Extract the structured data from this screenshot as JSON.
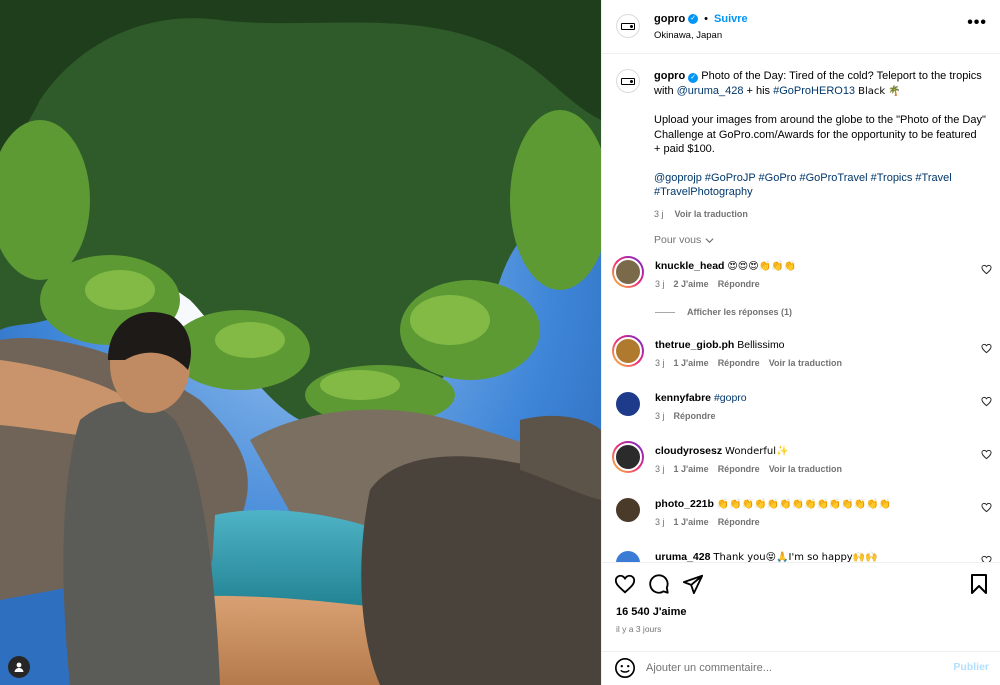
{
  "post": {
    "account": "gopro",
    "follow_label": "Suivre",
    "dot": "•",
    "location": "Okinawa, Japan",
    "more_label": "•••"
  },
  "caption": {
    "user": "gopro",
    "line1_text": "Photo of the Day: Tired of the cold? Teleport to the tropics with",
    "mention": "@uruma_428",
    "mid_text": "+ his",
    "hashtag_camera": "#GoProHERO13",
    "end_text": "Black 🌴",
    "paragraph2": "Upload your images from around the globe to the \"Photo of the Day\" Challenge at GoPro.com/Awards for the opportunity to be featured + paid $100.",
    "hashtags": "@goprojp #GoProJP #GoPro #GoProTravel #Tropics #Travel #TravelPhotography",
    "time": "3 j",
    "translate": "Voir la traduction"
  },
  "pour_vous": "Pour vous",
  "comments": [
    {
      "user": "knuckle_head",
      "text": "😍😍😍👏👏👏",
      "time": "3 j",
      "likes": "2 J'aime",
      "reply": "Répondre",
      "translate": "",
      "avatar_color": "#7a6a4a"
    },
    {
      "user": "thetrue_giob.ph",
      "text": "Bellissimo",
      "time": "3 j",
      "likes": "1 J'aime",
      "reply": "Répondre",
      "translate": "Voir la traduction",
      "avatar_color": "#b07a2e"
    },
    {
      "user": "kennyfabre",
      "text": "#gopro",
      "time": "3 j",
      "likes": "",
      "reply": "Répondre",
      "translate": "",
      "avatar_color": "#1e3a8a"
    },
    {
      "user": "cloudyrosesz",
      "text": "Wonderful✨",
      "time": "3 j",
      "likes": "1 J'aime",
      "reply": "Répondre",
      "translate": "Voir la traduction",
      "avatar_color": "#2b2b2b"
    },
    {
      "user": "photo_221b",
      "text": "👏👏👏👏👏👏👏👏👏👏👏👏👏👏",
      "time": "3 j",
      "likes": "1 J'aime",
      "reply": "Répondre",
      "translate": "",
      "avatar_color": "#4a3a2a"
    },
    {
      "user": "uruma_428",
      "text": "Thank you😝🙏I'm so happy🙌🙌",
      "time": "",
      "likes": "",
      "reply": "",
      "translate": "",
      "avatar_color": "#3a7bd5"
    }
  ],
  "replies_label": "Afficher les réponses (1)",
  "likes_count": "16 540 J'aime",
  "posted": "il y a 3 jours",
  "comment_box": {
    "placeholder": "Ajouter un commentaire...",
    "publish": "Publier"
  },
  "colors": {
    "accent": "#0095f6",
    "link": "#00376b",
    "muted": "#737373"
  },
  "icons": [
    "user-tag-icon",
    "verified-icon",
    "more-options-icon",
    "heart-icon",
    "comment-icon",
    "share-icon",
    "bookmark-icon",
    "emoji-icon",
    "chevron-down-icon"
  ]
}
